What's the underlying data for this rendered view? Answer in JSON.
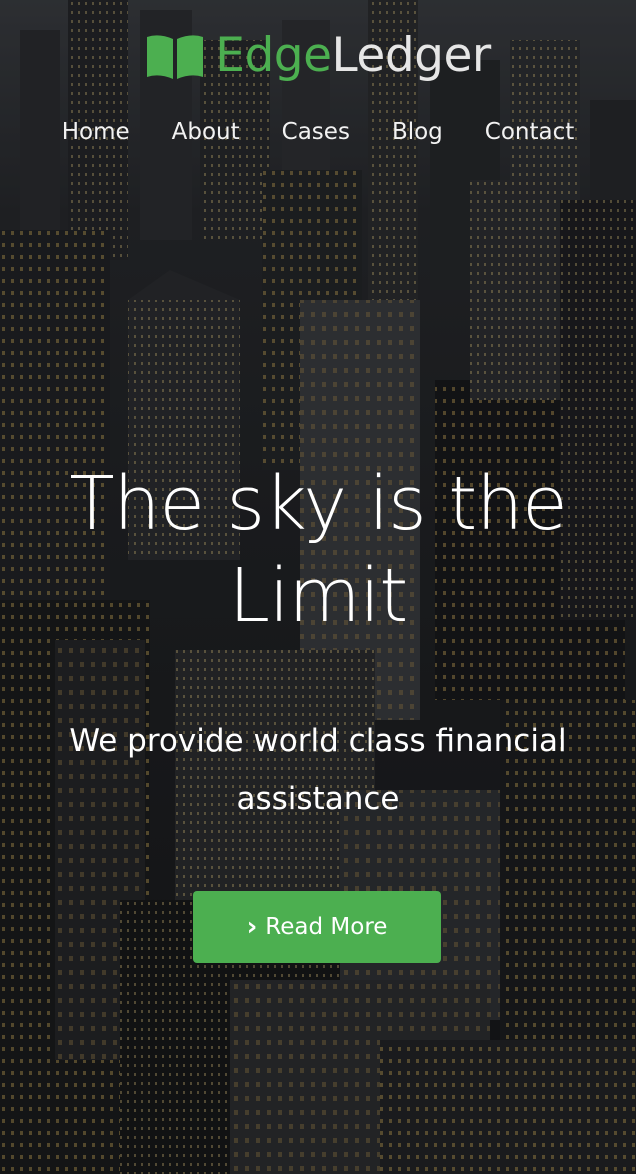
{
  "brand": {
    "name_part1": "Edge",
    "name_part2": "Ledger",
    "accent_color": "#4caf50",
    "icon": "open-book-icon"
  },
  "nav": {
    "items": [
      "Home",
      "About",
      "Cases",
      "Blog",
      "Contact"
    ]
  },
  "hero": {
    "headline": "The sky is the Limit",
    "tagline": "We provide world class financial assistance",
    "background": "night city skyline photo",
    "cta": {
      "label": "Read More",
      "icon": "chevron-right-icon",
      "color": "#4caf50"
    }
  }
}
